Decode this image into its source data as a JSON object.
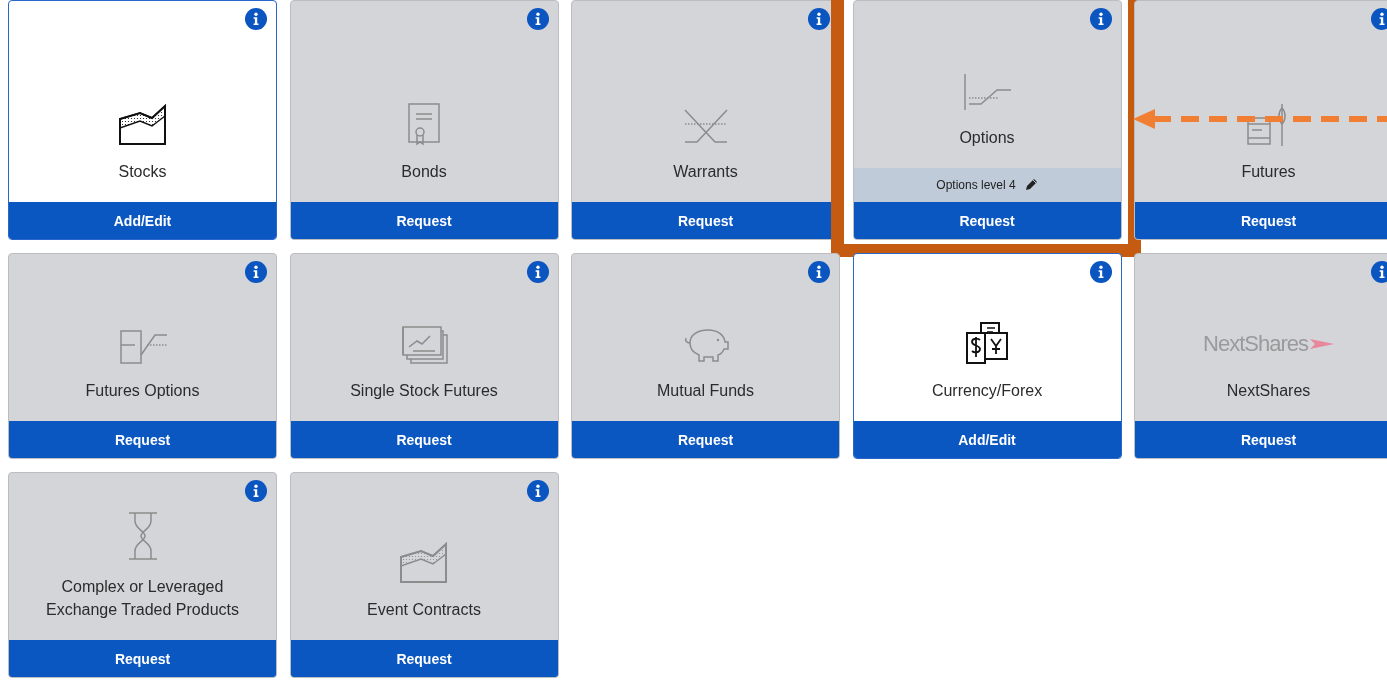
{
  "cards": [
    {
      "label": "Stocks",
      "active": true,
      "button": "Add/Edit",
      "highlighted": false
    },
    {
      "label": "Bonds",
      "active": false,
      "button": "Request",
      "highlighted": false
    },
    {
      "label": "Warrants",
      "active": false,
      "button": "Request",
      "highlighted": false
    },
    {
      "label": "Options",
      "active": false,
      "button": "Request",
      "highlighted": true,
      "level_note": "Options level 4"
    },
    {
      "label": "Futures",
      "active": false,
      "button": "Request",
      "highlighted": false
    },
    {
      "label": "Futures Options",
      "active": false,
      "button": "Request",
      "highlighted": false
    },
    {
      "label": "Single Stock Futures",
      "active": false,
      "button": "Request",
      "highlighted": false
    },
    {
      "label": "Mutual Funds",
      "active": false,
      "button": "Request",
      "highlighted": false
    },
    {
      "label": "Currency/Forex",
      "active": true,
      "button": "Add/Edit",
      "highlighted": false
    },
    {
      "label": "NextShares",
      "active": false,
      "button": "Request",
      "highlighted": false,
      "logo": "NextShares"
    },
    {
      "label": "Complex or Leveraged\nExchange Traded Products",
      "active": false,
      "button": "Request",
      "highlighted": false
    },
    {
      "label": "Event Contracts",
      "active": false,
      "button": "Request",
      "highlighted": false
    }
  ],
  "callout_arrow": true
}
